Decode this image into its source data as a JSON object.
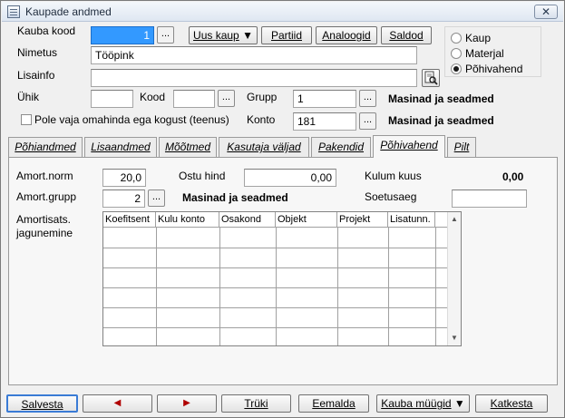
{
  "window": {
    "title": "Kaupade andmed",
    "close_glyph": "✕"
  },
  "header": {
    "kauba_kood_label": "Kauba kood",
    "kauba_kood_value": "1",
    "nimetus_label": "Nimetus",
    "nimetus_value": "Tööpink",
    "lisainfo_label": "Lisainfo",
    "lisainfo_value": "",
    "uhik_label": "Ühik",
    "uhik_value": "",
    "kood_label": "Kood",
    "kood_value": "",
    "grupp_label": "Grupp",
    "grupp_value": "1",
    "grupp_name": "Masinad ja seadmed",
    "konto_label": "Konto",
    "konto_value": "181",
    "konto_name": "Masinad ja seadmed",
    "checkbox_label": "Pole vaja omahinda ega kogust (teenus)",
    "dots_label": "..."
  },
  "top_buttons": {
    "uus_kaup": "Uus kaup",
    "uus_kaup_arrow": "▼",
    "partiid": "Partiid",
    "analoogid": "Analoogid",
    "saldod": "Saldod"
  },
  "type_radio": {
    "options": [
      "Kaup",
      "Materjal",
      "Põhivahend"
    ],
    "selected": "Põhivahend"
  },
  "tabs": [
    {
      "label": "Põhiandmed"
    },
    {
      "label": "Lisaandmed"
    },
    {
      "label": "Mõõtmed"
    },
    {
      "label": "Kasutaja väljad"
    },
    {
      "label": "Pakendid"
    },
    {
      "label": "Põhivahend"
    },
    {
      "label": "Pilt"
    }
  ],
  "active_tab": "Põhivahend",
  "pohivahend": {
    "amort_norm_label": "Amort.norm",
    "amort_norm_value": "20,0",
    "ostu_hind_label": "Ostu hind",
    "ostu_hind_value": "0,00",
    "kulum_kuus_label": "Kulum kuus",
    "kulum_kuus_value": "0,00",
    "amort_grupp_label": "Amort.grupp",
    "amort_grupp_value": "2",
    "amort_grupp_name": "Masinad ja seadmed",
    "soetusaeg_label": "Soetusaeg",
    "soetusaeg_value": "",
    "amortisats_label_1": "Amortisats.",
    "amortisats_label_2": "jagunemine",
    "grid_columns": [
      "Koefitsent",
      "Kulu konto",
      "Osakond",
      "Objekt",
      "Projekt",
      "Lisatunn."
    ]
  },
  "bottom_buttons": {
    "salvesta": "Salvesta",
    "prev": "◀",
    "next": "▶",
    "truki": "Trüki",
    "eemalda": "Eemalda",
    "kauba_muugid": "Kauba müügid",
    "kauba_muugid_arrow": "▼",
    "katkesta": "Katkesta"
  },
  "colors": {
    "selection": "#3399ff",
    "arrow_red": "#b00000"
  }
}
